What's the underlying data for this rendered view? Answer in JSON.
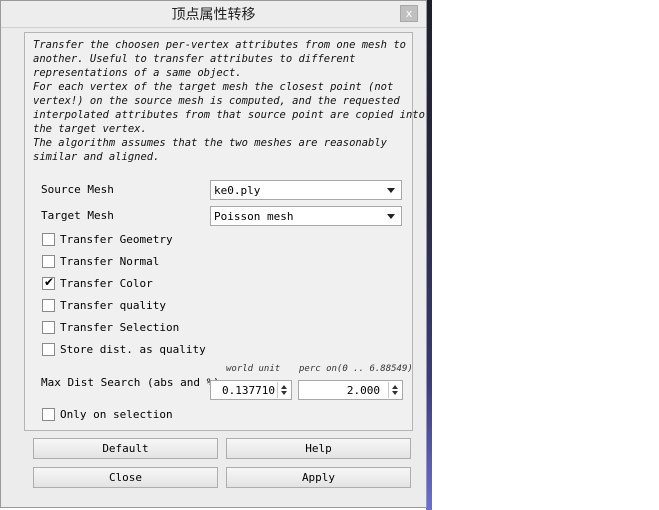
{
  "window": {
    "title": "顶点属性转移",
    "close_label": "x"
  },
  "description": [
    "Transfer the choosen per-vertex attributes from one mesh to",
    "another. Useful to transfer attributes to different",
    "representations of a same object.",
    "For each vertex of the target mesh the closest point (not",
    "vertex!) on the source mesh is computed, and the requested",
    "interpolated attributes from that source point are copied into",
    "the target vertex.",
    "The algorithm assumes that the two meshes are reasonably",
    "similar and aligned."
  ],
  "source_mesh": {
    "label": "Source Mesh",
    "value": "ke0.ply"
  },
  "target_mesh": {
    "label": "Target Mesh",
    "value": "Poisson mesh"
  },
  "options": [
    {
      "label": "Transfer Geometry",
      "checked": false
    },
    {
      "label": "Transfer Normal",
      "checked": false
    },
    {
      "label": "Transfer Color",
      "checked": true
    },
    {
      "label": "Transfer quality",
      "checked": false
    },
    {
      "label": "Transfer Selection",
      "checked": false
    },
    {
      "label": "Store dist. as quality",
      "checked": false
    }
  ],
  "max_dist": {
    "label": "Max Dist Search (abs and %)",
    "world_unit_hint": "world unit",
    "percent_hint": "perc on(0 .. 6.88549)",
    "world_value": "0.137710",
    "percent_value": "2.000"
  },
  "only_selection": {
    "label": "Only on selection",
    "checked": false
  },
  "buttons": {
    "default": "Default",
    "help": "Help",
    "close": "Close",
    "apply": "Apply"
  }
}
